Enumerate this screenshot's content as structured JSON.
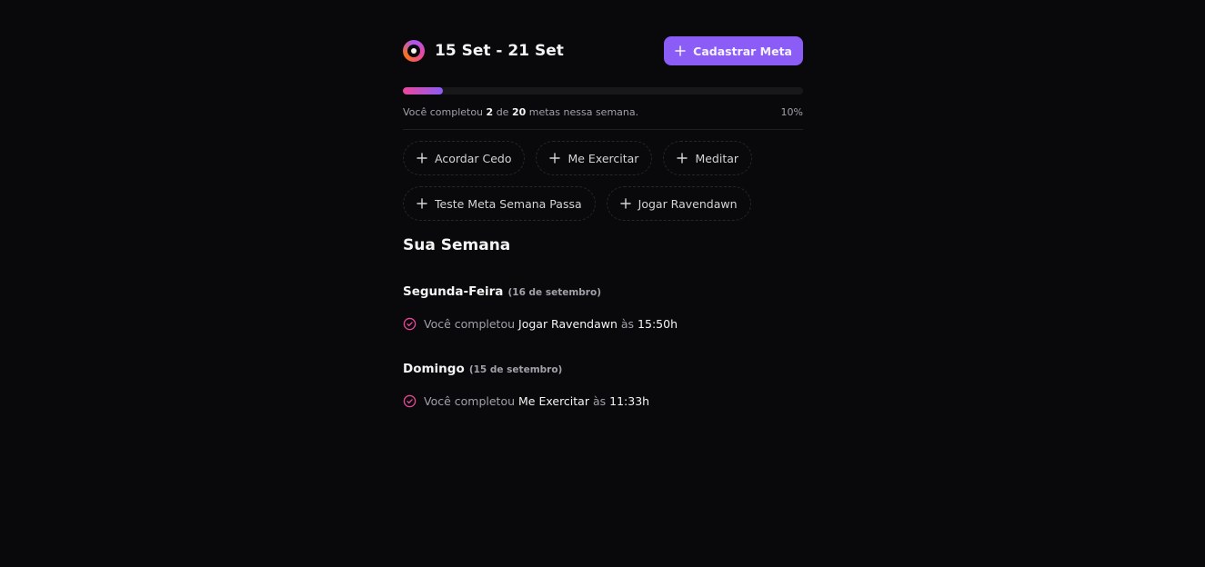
{
  "header": {
    "week_label": "15 Set - 21 Set",
    "create_button_label": "Cadastrar Meta"
  },
  "progress": {
    "completed": "2",
    "total": "20",
    "text_prefix": "Você completou",
    "text_of": "de",
    "text_suffix": "metas nessa semana.",
    "percent_label": "10%",
    "fraction": 0.1
  },
  "pending_goals": [
    {
      "label": "Acordar Cedo"
    },
    {
      "label": "Me Exercitar"
    },
    {
      "label": "Meditar"
    },
    {
      "label": "Teste Meta Semana Passa"
    },
    {
      "label": "Jogar Ravendawn"
    }
  ],
  "summary": {
    "title": "Sua Semana",
    "days": [
      {
        "weekday": "Segunda-Feira",
        "date": "(16 de setembro)",
        "completions": [
          {
            "prefix": "Você completou",
            "goal": "Jogar Ravendawn",
            "at": "às",
            "time": "15:50h"
          }
        ]
      },
      {
        "weekday": "Domingo",
        "date": "(15 de setembro)",
        "completions": [
          {
            "prefix": "Você completou",
            "goal": "Me Exercitar",
            "at": "às",
            "time": "11:33h"
          }
        ]
      }
    ]
  },
  "colors": {
    "accent": "#8b5cf6",
    "accent_pink": "#ec4899",
    "background": "#09090b"
  },
  "icons": {
    "logo": "target-logo-icon",
    "add": "plus-icon",
    "done": "check-circle-icon"
  }
}
